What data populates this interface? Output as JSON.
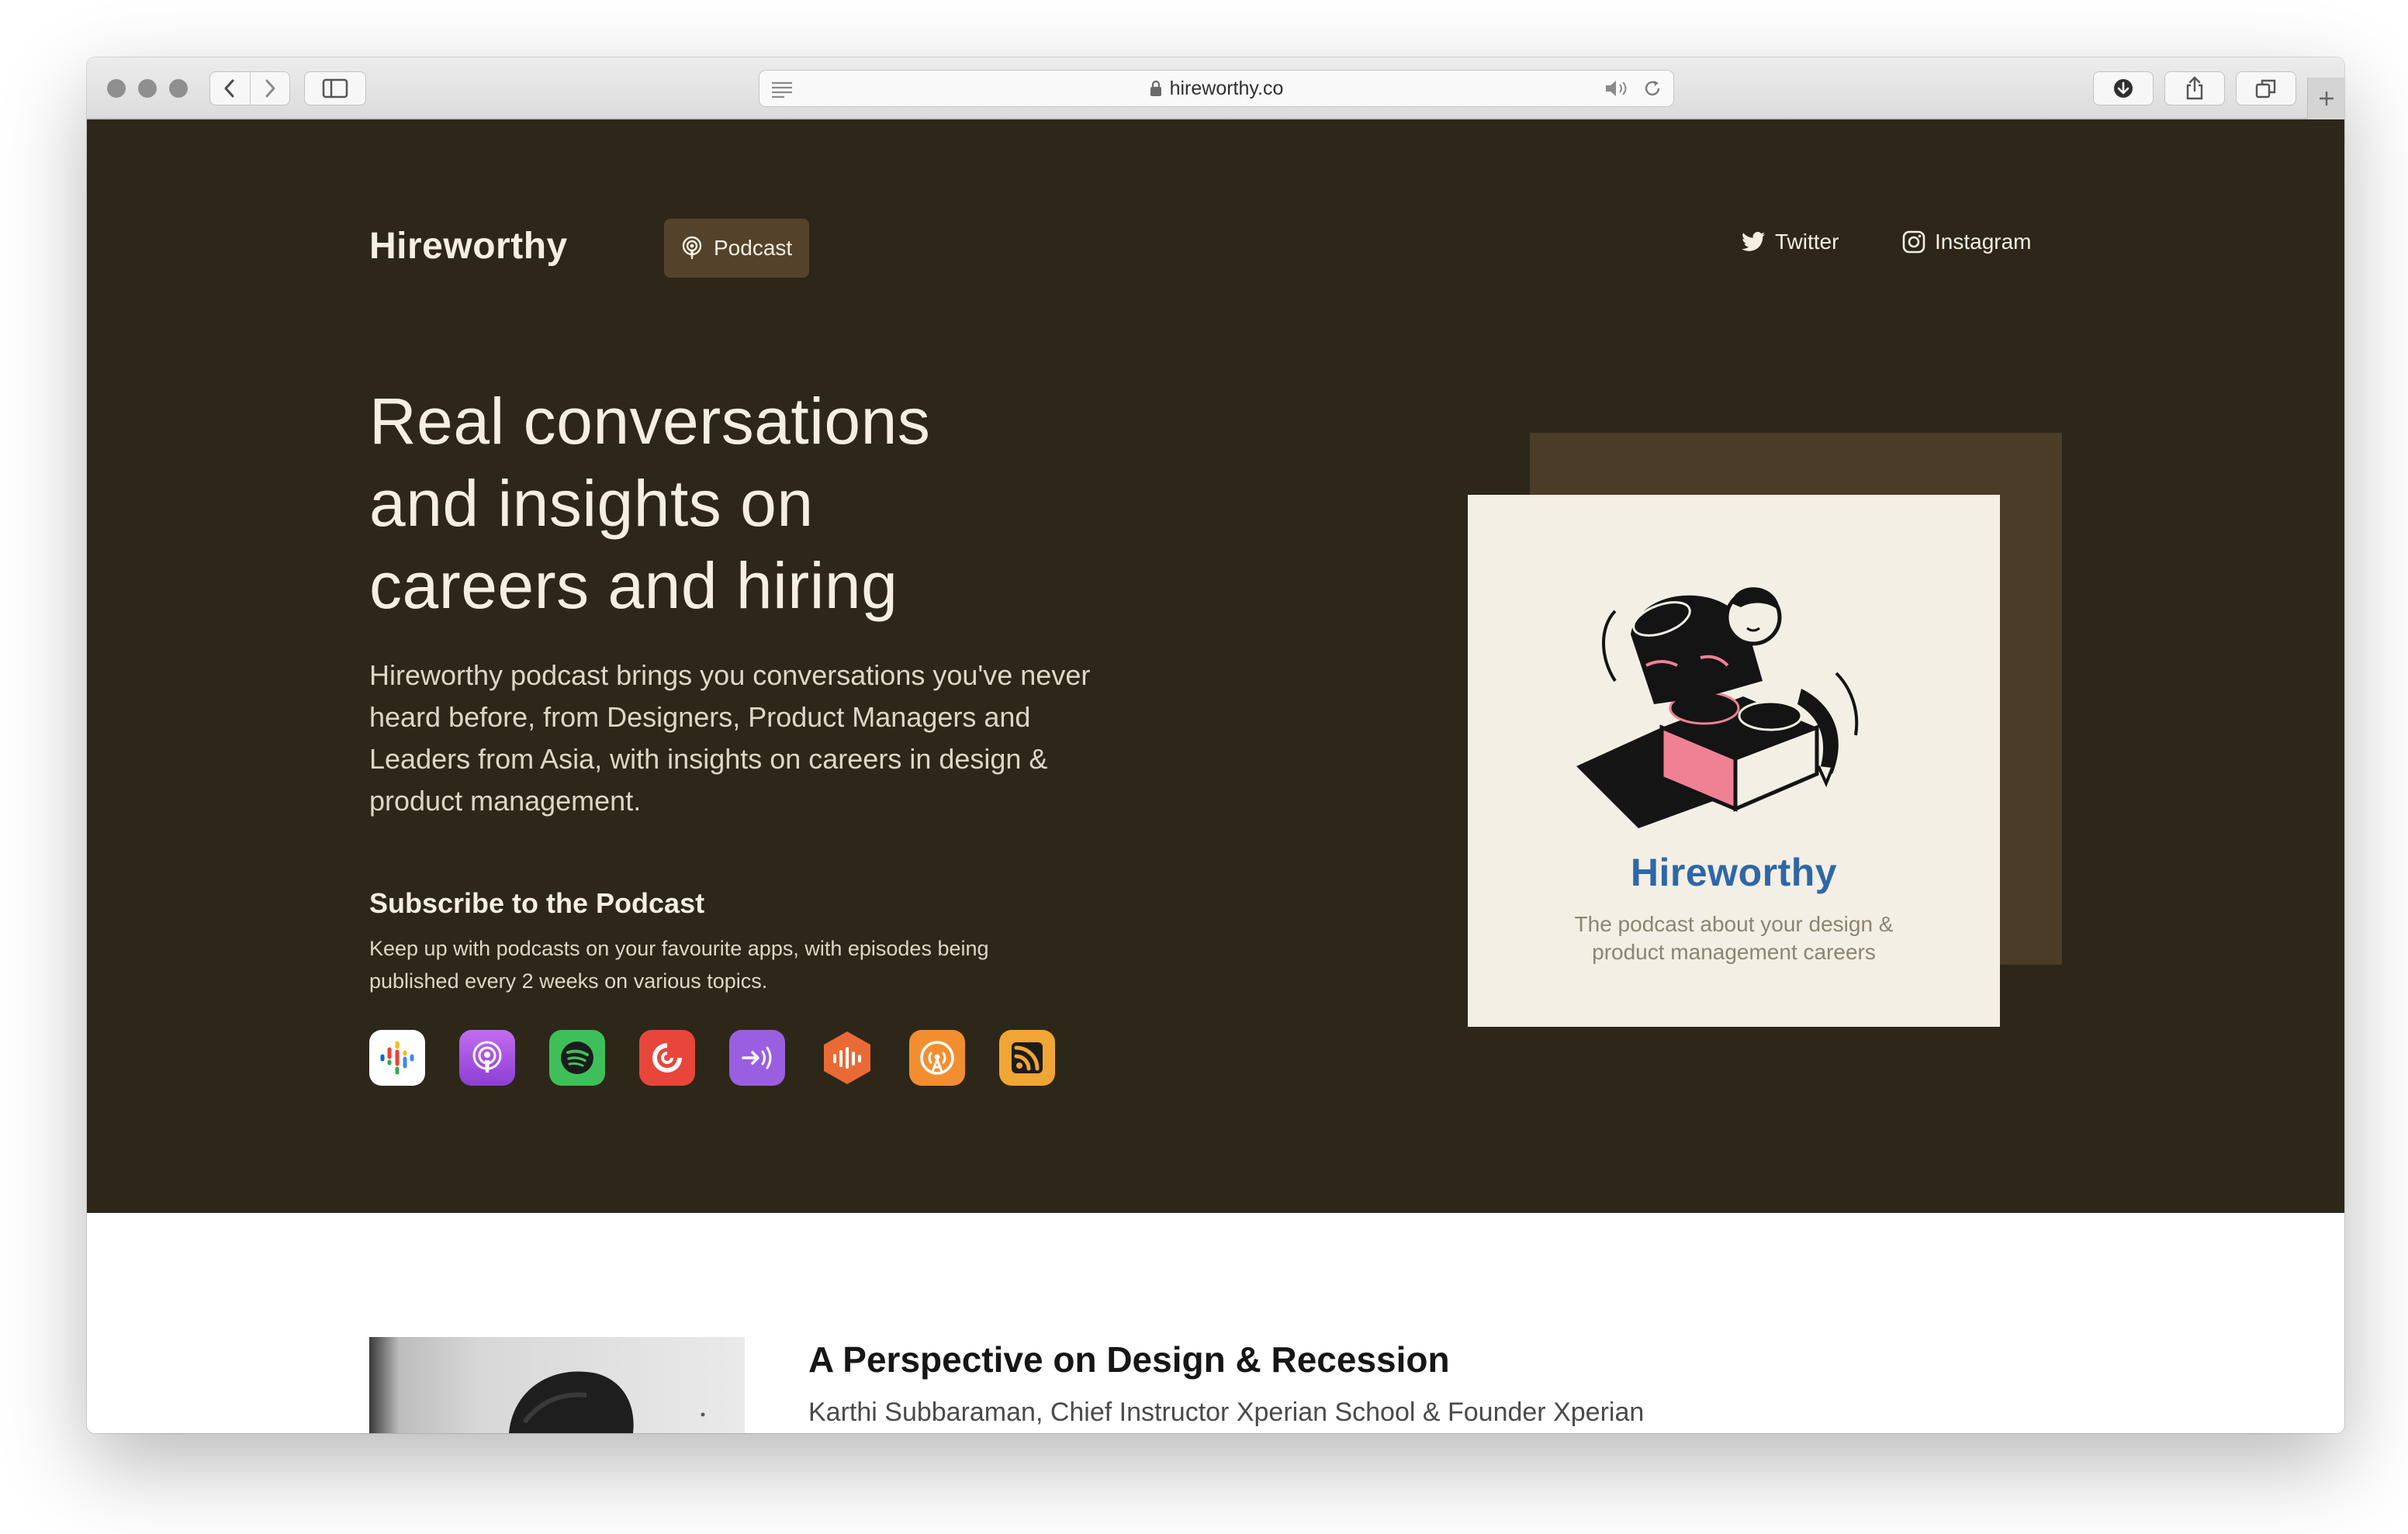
{
  "browser": {
    "url": "hireworthy.co"
  },
  "nav": {
    "logo": "Hireworthy",
    "podcast_label": "Podcast",
    "twitter_label": "Twitter",
    "instagram_label": "Instagram"
  },
  "hero": {
    "headline_lines": [
      "Real conversations",
      "and insights on",
      "careers and hiring"
    ],
    "description": "Hireworthy podcast brings you conversations you've never heard before, from Designers, Product Managers and Leaders from Asia, with insights on careers in design & product management.",
    "subscribe_title": "Subscribe to the Podcast",
    "subscribe_description": "Keep up with podcasts on your favourite apps, with episodes being published every 2 weeks on various topics."
  },
  "apps": [
    {
      "icon": "google-podcasts-icon",
      "color": "#ffffff"
    },
    {
      "icon": "apple-podcasts-icon",
      "color": "#a45fe0"
    },
    {
      "icon": "spotify-icon",
      "color": "#3fbf5a"
    },
    {
      "icon": "pocket-casts-icon",
      "color": "#e8463b"
    },
    {
      "icon": "podcast-addict-icon",
      "color": "#9a5fe0"
    },
    {
      "icon": "castbox-icon",
      "color": "#ea6a35"
    },
    {
      "icon": "overcast-icon",
      "color": "#f28e30"
    },
    {
      "icon": "rss-icon",
      "color": "#f1a534"
    }
  ],
  "cover": {
    "title": "Hireworthy",
    "tagline_lines": [
      "The podcast about your design &",
      "product management careers"
    ]
  },
  "episode": {
    "title": "A Perspective on Design & Recession",
    "guest": "Karthi Subbaraman, Chief Instructor Xperian School & Founder Xperian"
  },
  "colors": {
    "hero_bg": "#2d2719",
    "pill_bg": "#54432a",
    "cover_bg": "#f3efe4",
    "cover_title": "#2e67a8",
    "accent_pink": "#f08195"
  }
}
